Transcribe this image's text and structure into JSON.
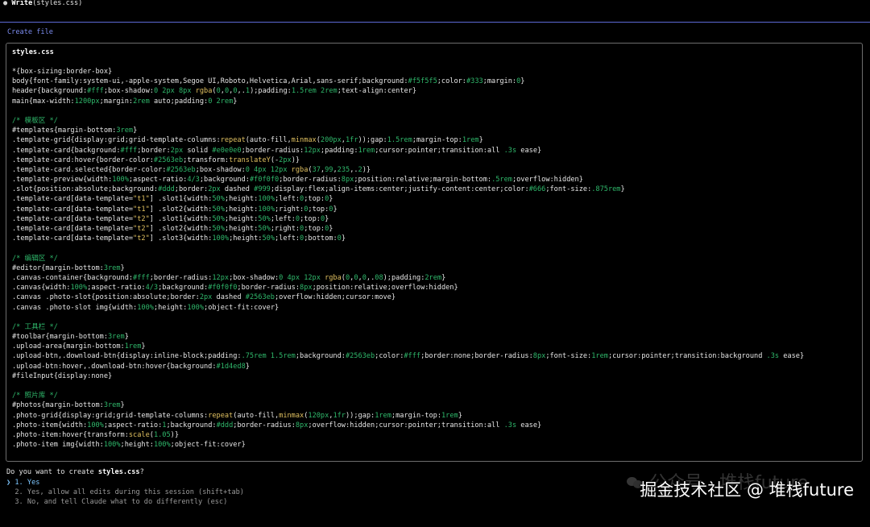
{
  "header": {
    "bullet": "●",
    "tool": "Write",
    "arg": "(styles.css)"
  },
  "create_label": "Create file",
  "file": {
    "name": "styles.css",
    "lines": [
      [
        [
          "*{box-sizing:border-box}",
          ""
        ]
      ],
      [
        [
          "body{font-family:system-ui,-apple-system,Segoe UI,Roboto,Helvetica,Arial,sans-serif;background:",
          ""
        ],
        [
          "#f5f5f5",
          "n"
        ],
        [
          ";color:",
          ""
        ],
        [
          "#333",
          "n"
        ],
        [
          ";margin:",
          ""
        ],
        [
          "0",
          "n"
        ],
        [
          "}",
          ""
        ]
      ],
      [
        [
          "header{background:",
          ""
        ],
        [
          "#fff",
          "n"
        ],
        [
          ";box-shadow:",
          ""
        ],
        [
          "0 2px 8px ",
          "n"
        ],
        [
          "rgba",
          "s"
        ],
        [
          "(",
          ""
        ],
        [
          "0",
          "n"
        ],
        [
          ",",
          ""
        ],
        [
          "0",
          "n"
        ],
        [
          ",",
          ""
        ],
        [
          "0",
          "n"
        ],
        [
          ",.",
          ""
        ],
        [
          "1",
          "n"
        ],
        [
          ");padding:",
          ""
        ],
        [
          "1.5rem 2rem",
          "n"
        ],
        [
          ";text-align:center}",
          ""
        ]
      ],
      [
        [
          "main{max-width:",
          ""
        ],
        [
          "1200px",
          "n"
        ],
        [
          ";margin:",
          ""
        ],
        [
          "2rem",
          "n"
        ],
        [
          " auto;padding:",
          ""
        ],
        [
          "0 2rem",
          "n"
        ],
        [
          "}",
          ""
        ]
      ],
      [
        [
          "",
          ""
        ]
      ],
      [
        [
          "/* 模板区 */",
          "c"
        ]
      ],
      [
        [
          "#templates{margin-bottom:",
          ""
        ],
        [
          "3rem",
          "n"
        ],
        [
          "}",
          ""
        ]
      ],
      [
        [
          ".template-grid{display:grid;grid-template-columns:",
          ""
        ],
        [
          "repeat",
          "s"
        ],
        [
          "(auto-fill,",
          ""
        ],
        [
          "minmax",
          "s"
        ],
        [
          "(",
          ""
        ],
        [
          "200px",
          "n"
        ],
        [
          ",",
          ""
        ],
        [
          "1fr",
          "n"
        ],
        [
          "));gap:",
          ""
        ],
        [
          "1.5rem",
          "n"
        ],
        [
          ";margin-top:",
          ""
        ],
        [
          "1rem",
          "n"
        ],
        [
          "}",
          ""
        ]
      ],
      [
        [
          ".template-card{background:",
          ""
        ],
        [
          "#fff",
          "n"
        ],
        [
          ";border:",
          ""
        ],
        [
          "2px",
          "n"
        ],
        [
          " solid ",
          ""
        ],
        [
          "#e0e0e0",
          "n"
        ],
        [
          ";border-radius:",
          ""
        ],
        [
          "12px",
          "n"
        ],
        [
          ";padding:",
          ""
        ],
        [
          "1rem",
          "n"
        ],
        [
          ";cursor:pointer;transition:all ",
          ""
        ],
        [
          ".3s",
          "n"
        ],
        [
          " ease}",
          ""
        ]
      ],
      [
        [
          ".template-card:hover{border-color:",
          ""
        ],
        [
          "#2563eb",
          "n"
        ],
        [
          ";transform:",
          ""
        ],
        [
          "translateY",
          "s"
        ],
        [
          "(-",
          ""
        ],
        [
          "2px",
          "n"
        ],
        [
          ")}",
          ""
        ]
      ],
      [
        [
          ".template-card.selected{border-color:",
          ""
        ],
        [
          "#2563eb",
          "n"
        ],
        [
          ";box-shadow:",
          ""
        ],
        [
          "0 4px 12px ",
          "n"
        ],
        [
          "rgba",
          "s"
        ],
        [
          "(",
          ""
        ],
        [
          "37",
          "n"
        ],
        [
          ",",
          ""
        ],
        [
          "99",
          "n"
        ],
        [
          ",",
          ""
        ],
        [
          "235",
          "n"
        ],
        [
          ",.",
          ""
        ],
        [
          "2",
          "n"
        ],
        [
          ")}",
          ""
        ]
      ],
      [
        [
          ".template-preview{width:",
          ""
        ],
        [
          "100%",
          "n"
        ],
        [
          ";aspect-ratio:",
          ""
        ],
        [
          "4/3",
          "n"
        ],
        [
          ";background:",
          ""
        ],
        [
          "#f0f0f0",
          "n"
        ],
        [
          ";border-radius:",
          ""
        ],
        [
          "8px",
          "n"
        ],
        [
          ";position:relative;margin-bottom:",
          ""
        ],
        [
          ".5rem",
          "n"
        ],
        [
          ";overflow:hidden}",
          ""
        ]
      ],
      [
        [
          ".slot{position:absolute;background:",
          ""
        ],
        [
          "#ddd",
          "n"
        ],
        [
          ";border:",
          ""
        ],
        [
          "2px",
          "n"
        ],
        [
          " dashed ",
          ""
        ],
        [
          "#999",
          "n"
        ],
        [
          ";display:flex;align-items:center;justify-content:center;color:",
          ""
        ],
        [
          "#666",
          "n"
        ],
        [
          ";font-size:",
          ""
        ],
        [
          ".875rem",
          "n"
        ],
        [
          "}",
          ""
        ]
      ],
      [
        [
          ".template-card[data-template=",
          ""
        ],
        [
          "\"t1\"",
          "s"
        ],
        [
          "] .slot1{width:",
          ""
        ],
        [
          "50%",
          "n"
        ],
        [
          ";height:",
          ""
        ],
        [
          "100%",
          "n"
        ],
        [
          ";left:",
          ""
        ],
        [
          "0",
          "n"
        ],
        [
          ";top:",
          ""
        ],
        [
          "0",
          "n"
        ],
        [
          "}",
          ""
        ]
      ],
      [
        [
          ".template-card[data-template=",
          ""
        ],
        [
          "\"t1\"",
          "s"
        ],
        [
          "] .slot2{width:",
          ""
        ],
        [
          "50%",
          "n"
        ],
        [
          ";height:",
          ""
        ],
        [
          "100%",
          "n"
        ],
        [
          ";right:",
          ""
        ],
        [
          "0",
          "n"
        ],
        [
          ";top:",
          ""
        ],
        [
          "0",
          "n"
        ],
        [
          "}",
          ""
        ]
      ],
      [
        [
          ".template-card[data-template=",
          ""
        ],
        [
          "\"t2\"",
          "s"
        ],
        [
          "] .slot1{width:",
          ""
        ],
        [
          "50%",
          "n"
        ],
        [
          ";height:",
          ""
        ],
        [
          "50%",
          "n"
        ],
        [
          ";left:",
          ""
        ],
        [
          "0",
          "n"
        ],
        [
          ";top:",
          ""
        ],
        [
          "0",
          "n"
        ],
        [
          "}",
          ""
        ]
      ],
      [
        [
          ".template-card[data-template=",
          ""
        ],
        [
          "\"t2\"",
          "s"
        ],
        [
          "] .slot2{width:",
          ""
        ],
        [
          "50%",
          "n"
        ],
        [
          ";height:",
          ""
        ],
        [
          "50%",
          "n"
        ],
        [
          ";right:",
          ""
        ],
        [
          "0",
          "n"
        ],
        [
          ";top:",
          ""
        ],
        [
          "0",
          "n"
        ],
        [
          "}",
          ""
        ]
      ],
      [
        [
          ".template-card[data-template=",
          ""
        ],
        [
          "\"t2\"",
          "s"
        ],
        [
          "] .slot3{width:",
          ""
        ],
        [
          "100%",
          "n"
        ],
        [
          ";height:",
          ""
        ],
        [
          "50%",
          "n"
        ],
        [
          ";left:",
          ""
        ],
        [
          "0",
          "n"
        ],
        [
          ";bottom:",
          ""
        ],
        [
          "0",
          "n"
        ],
        [
          "}",
          ""
        ]
      ],
      [
        [
          "",
          ""
        ]
      ],
      [
        [
          "/* 编辑区 */",
          "c"
        ]
      ],
      [
        [
          "#editor{margin-bottom:",
          ""
        ],
        [
          "3rem",
          "n"
        ],
        [
          "}",
          ""
        ]
      ],
      [
        [
          ".canvas-container{background:",
          ""
        ],
        [
          "#fff",
          "n"
        ],
        [
          ";border-radius:",
          ""
        ],
        [
          "12px",
          "n"
        ],
        [
          ";box-shadow:",
          ""
        ],
        [
          "0 4px 12px ",
          "n"
        ],
        [
          "rgba",
          "s"
        ],
        [
          "(",
          ""
        ],
        [
          "0",
          "n"
        ],
        [
          ",",
          ""
        ],
        [
          "0",
          "n"
        ],
        [
          ",",
          ""
        ],
        [
          "0",
          "n"
        ],
        [
          ",.",
          ""
        ],
        [
          "08",
          "n"
        ],
        [
          ");padding:",
          ""
        ],
        [
          "2rem",
          "n"
        ],
        [
          "}",
          ""
        ]
      ],
      [
        [
          ".canvas{width:",
          ""
        ],
        [
          "100%",
          "n"
        ],
        [
          ";aspect-ratio:",
          ""
        ],
        [
          "4/3",
          "n"
        ],
        [
          ";background:",
          ""
        ],
        [
          "#f0f0f0",
          "n"
        ],
        [
          ";border-radius:",
          ""
        ],
        [
          "8px",
          "n"
        ],
        [
          ";position:relative;overflow:hidden}",
          ""
        ]
      ],
      [
        [
          ".canvas .photo-slot{position:absolute;border:",
          ""
        ],
        [
          "2px",
          "n"
        ],
        [
          " dashed ",
          ""
        ],
        [
          "#2563eb",
          "n"
        ],
        [
          ";overflow:hidden;cursor:move}",
          ""
        ]
      ],
      [
        [
          ".canvas .photo-slot img{width:",
          ""
        ],
        [
          "100%",
          "n"
        ],
        [
          ";height:",
          ""
        ],
        [
          "100%",
          "n"
        ],
        [
          ";object-fit:cover}",
          ""
        ]
      ],
      [
        [
          "",
          ""
        ]
      ],
      [
        [
          "/* 工具栏 */",
          "c"
        ]
      ],
      [
        [
          "#toolbar{margin-bottom:",
          ""
        ],
        [
          "3rem",
          "n"
        ],
        [
          "}",
          ""
        ]
      ],
      [
        [
          ".upload-area{margin-bottom:",
          ""
        ],
        [
          "1rem",
          "n"
        ],
        [
          "}",
          ""
        ]
      ],
      [
        [
          ".upload-btn,.download-btn{display:inline-block;padding:",
          ""
        ],
        [
          ".75rem 1.5rem",
          "n"
        ],
        [
          ";background:",
          ""
        ],
        [
          "#2563eb",
          "n"
        ],
        [
          ";color:",
          ""
        ],
        [
          "#fff",
          "n"
        ],
        [
          ";border:none;border-radius:",
          ""
        ],
        [
          "8px",
          "n"
        ],
        [
          ";font-size:",
          ""
        ],
        [
          "1rem",
          "n"
        ],
        [
          ";cursor:pointer;transition:background ",
          ""
        ],
        [
          ".3s",
          "n"
        ],
        [
          " ease}",
          ""
        ]
      ],
      [
        [
          ".upload-btn:hover,.download-btn:hover{background:",
          ""
        ],
        [
          "#1d4ed8",
          "n"
        ],
        [
          "}",
          ""
        ]
      ],
      [
        [
          "#fileInput{display:none}",
          ""
        ]
      ],
      [
        [
          "",
          ""
        ]
      ],
      [
        [
          "/* 照片库 */",
          "c"
        ]
      ],
      [
        [
          "#photos{margin-bottom:",
          ""
        ],
        [
          "3rem",
          "n"
        ],
        [
          "}",
          ""
        ]
      ],
      [
        [
          ".photo-grid{display:grid;grid-template-columns:",
          ""
        ],
        [
          "repeat",
          "s"
        ],
        [
          "(auto-fill,",
          ""
        ],
        [
          "minmax",
          "s"
        ],
        [
          "(",
          ""
        ],
        [
          "120px",
          "n"
        ],
        [
          ",",
          ""
        ],
        [
          "1fr",
          "n"
        ],
        [
          "));gap:",
          ""
        ],
        [
          "1rem",
          "n"
        ],
        [
          ";margin-top:",
          ""
        ],
        [
          "1rem",
          "n"
        ],
        [
          "}",
          ""
        ]
      ],
      [
        [
          ".photo-item{width:",
          ""
        ],
        [
          "100%",
          "n"
        ],
        [
          ";aspect-ratio:",
          ""
        ],
        [
          "1",
          "n"
        ],
        [
          ";background:",
          ""
        ],
        [
          "#ddd",
          "n"
        ],
        [
          ";border-radius:",
          ""
        ],
        [
          "8px",
          "n"
        ],
        [
          ";overflow:hidden;cursor:pointer;transition:all ",
          ""
        ],
        [
          ".3s",
          "n"
        ],
        [
          " ease}",
          ""
        ]
      ],
      [
        [
          ".photo-item:hover{transform:",
          ""
        ],
        [
          "scale",
          "s"
        ],
        [
          "(",
          ""
        ],
        [
          "1.05",
          "n"
        ],
        [
          ")}",
          ""
        ]
      ],
      [
        [
          ".photo-item img{width:",
          ""
        ],
        [
          "100%",
          "n"
        ],
        [
          ";height:",
          ""
        ],
        [
          "100%",
          "n"
        ],
        [
          ";object-fit:cover}",
          ""
        ]
      ]
    ]
  },
  "question": {
    "before": "Do you want to create ",
    "file": "styles.css",
    "after": "?"
  },
  "options": [
    {
      "marker": "❯",
      "num": "1.",
      "label": "Yes"
    },
    {
      "marker": " ",
      "num": "2.",
      "label": "Yes, allow all edits during this session (shift+tab)"
    },
    {
      "marker": " ",
      "num": "3.",
      "label": "No, and tell Claude what to do differently (esc)"
    }
  ],
  "watermark": {
    "faint": "公众号 · 堆栈future",
    "main": "掘金技术社区 @ 堆栈future"
  },
  "colors": {
    "accent": "#7c8cf0",
    "number": "#2fb86b",
    "selected": "#7ec7ff"
  }
}
